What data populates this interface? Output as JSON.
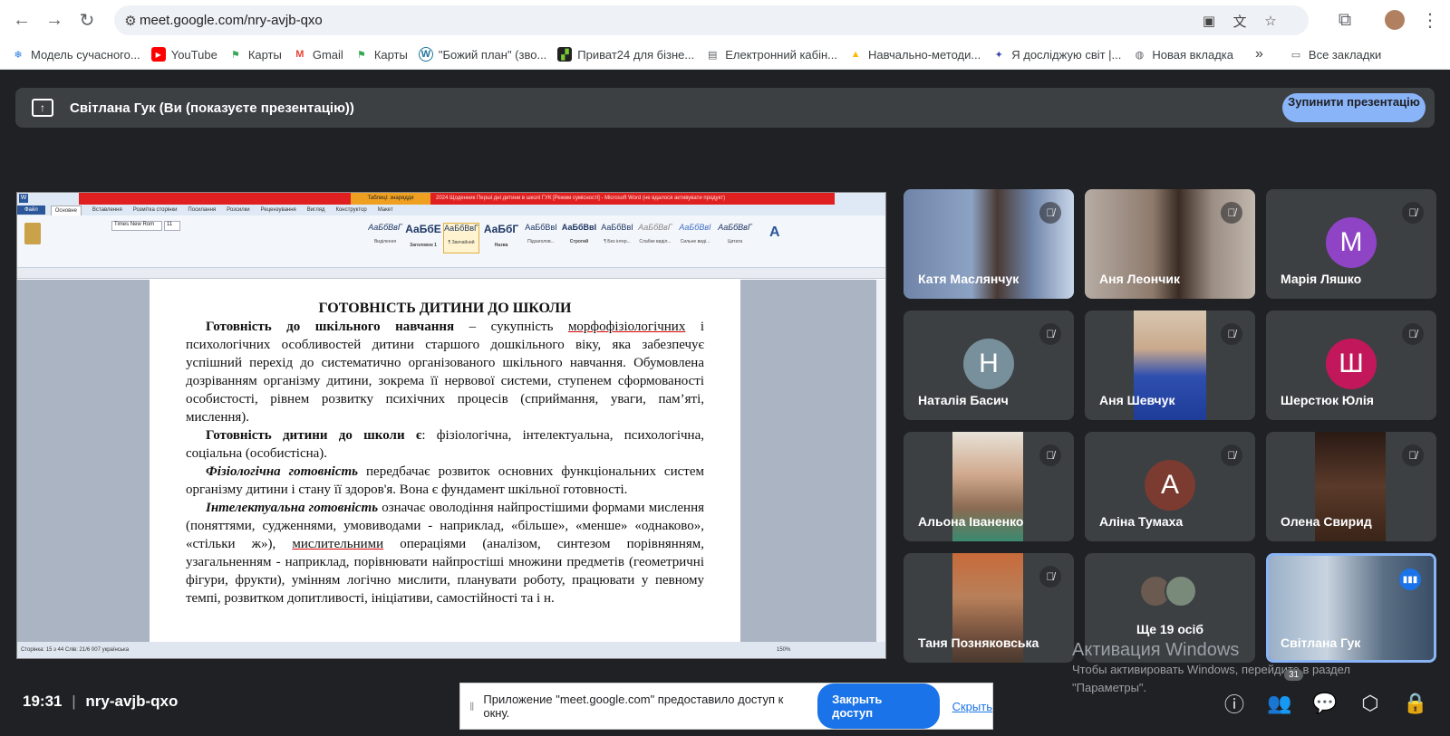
{
  "browser": {
    "url": "meet.google.com/nry-avjb-qxo",
    "bookmarks": [
      "Модель сучасного...",
      "YouTube",
      "Карты",
      "Gmail",
      "Карты",
      "\"Божий план\" (зво...",
      "Приват24 для бізне...",
      "Електронний кабін...",
      "Навчально-методи...",
      "Я досліджую світ |...",
      "Новая вкладка"
    ],
    "all_bookmarks": "Все закладки",
    "more": "»"
  },
  "presenting": {
    "title": "Світлана Гук (Ви (показуєте презентацію))",
    "stop_label": "Зупинити презентацію"
  },
  "word": {
    "tabs": [
      "Файл",
      "Основне",
      "Вставлення",
      "Розмітка сторінки",
      "Посилання",
      "Розсилки",
      "Рецензування",
      "Вигляд",
      "Конструктор",
      "Макет"
    ],
    "context_tab": "Таблиці: знаряддя",
    "title": "2024 Щоденник Перші дні дитини в школі ГУК [Режим сумісності] - Microsoft Word (не вдалося активувати продукт)",
    "styles": [
      "Виділення",
      "Заголовок 1",
      "¶ Звичайний",
      "Назва",
      "Підзаголов...",
      "Строгий",
      "¶ Без інтер...",
      "Слабке виділ...",
      "Сильне виді...",
      "Цитата"
    ],
    "font": "Times New Rom",
    "size": "11",
    "status": "Сторінка: 15 з 44   Слів: 21/6 007   українська",
    "zoom": "150%",
    "doc_heading": "ГОТОВНІСТЬ ДИТИНИ ДО ШКОЛИ",
    "p1_b": "Готовність до шкільного навчання",
    "p1_a": " – сукупність ",
    "p1_u": "морфофізіологічних",
    "p1_c": " і психологічних особливостей дитини старшого дошкільного віку, яка забезпечує успішний перехід до систематично організованого шкільного навчання. Обумовлена дозріванням організму дитини, зокрема її нервової системи, ступенем сформованості особистості, рівнем розвитку психічних процесів (сприймання, уваги, пам’яті, мислення).",
    "p2_b": "Готовність дитини до школи є",
    "p2_a": ": фізіологічна, інтелектуальна, психологічна, соціальна (особистісна).",
    "p3_b": "Фізіологічна готовність",
    "p3_a": " передбачає розвиток основних функціональних систем організму дитини і стану її здоров'я. Вона є фундамент шкільної готовності.",
    "p4_b": "Інтелектуальна готовність",
    "p4_a": " означає оволодіння найпростішими формами мислення (поняттями, судженнями, умовиводами - наприклад, «більше», «менше» «однаково», «стільки ж»), ",
    "p4_u": "мислительними",
    "p4_c": " операціями (аналізом, синтезом порівнянням, узагальненням - наприклад, порівнювати найпростіші множини предметів (геометричні фігури, фрукти), умінням логічно мислити, планувати роботу, працювати у певному темпі, розвитком допитливості, ініціативи, самостійності та і н."
  },
  "participants": [
    {
      "name": "Катя Маслянчук",
      "type": "video",
      "muted": true
    },
    {
      "name": "Аня Леончик",
      "type": "video",
      "muted": true
    },
    {
      "name": "Марія Ляшко",
      "type": "avatar",
      "letter": "M",
      "color": "#8e44c4",
      "muted": true
    },
    {
      "name": "Наталія Басич",
      "type": "avatar",
      "letter": "Н",
      "color": "#78909c",
      "muted": true
    },
    {
      "name": "Аня Шевчук",
      "type": "video",
      "muted": true
    },
    {
      "name": "Шерстюк Юлія",
      "type": "avatar",
      "letter": "Ш",
      "color": "#c2185b",
      "muted": true
    },
    {
      "name": "Альона Іваненко",
      "type": "video",
      "muted": true
    },
    {
      "name": "Аліна Тумаха",
      "type": "avatar",
      "letter": "А",
      "color": "#7b3b30",
      "muted": true
    },
    {
      "name": "Олена Свирид",
      "type": "video",
      "muted": true
    },
    {
      "name": "Таня Позняковська",
      "type": "video",
      "muted": true
    },
    {
      "name": "Ще 19 осіб",
      "type": "more"
    },
    {
      "name": "Світлана Гук",
      "type": "video",
      "muted": false
    }
  ],
  "windows_activation": {
    "line1": "Активация Windows",
    "line2": "Чтобы активировать Windows, перейдите в раздел",
    "line3": "\"Параметры\"."
  },
  "bottom": {
    "time": "19:31",
    "separator": "|",
    "meeting_code": "nry-avjb-qxo",
    "participant_count": "31"
  },
  "share_notice": {
    "text": "Приложение \"meet.google.com\" предоставило доступ к окну.",
    "grant": "Закрыть доступ",
    "hide": "Скрыть"
  },
  "colors": {
    "meet_bg": "#202124",
    "tile_bg": "#3c4043",
    "accent": "#8ab4f8",
    "active_border": "#8ab4f8"
  }
}
